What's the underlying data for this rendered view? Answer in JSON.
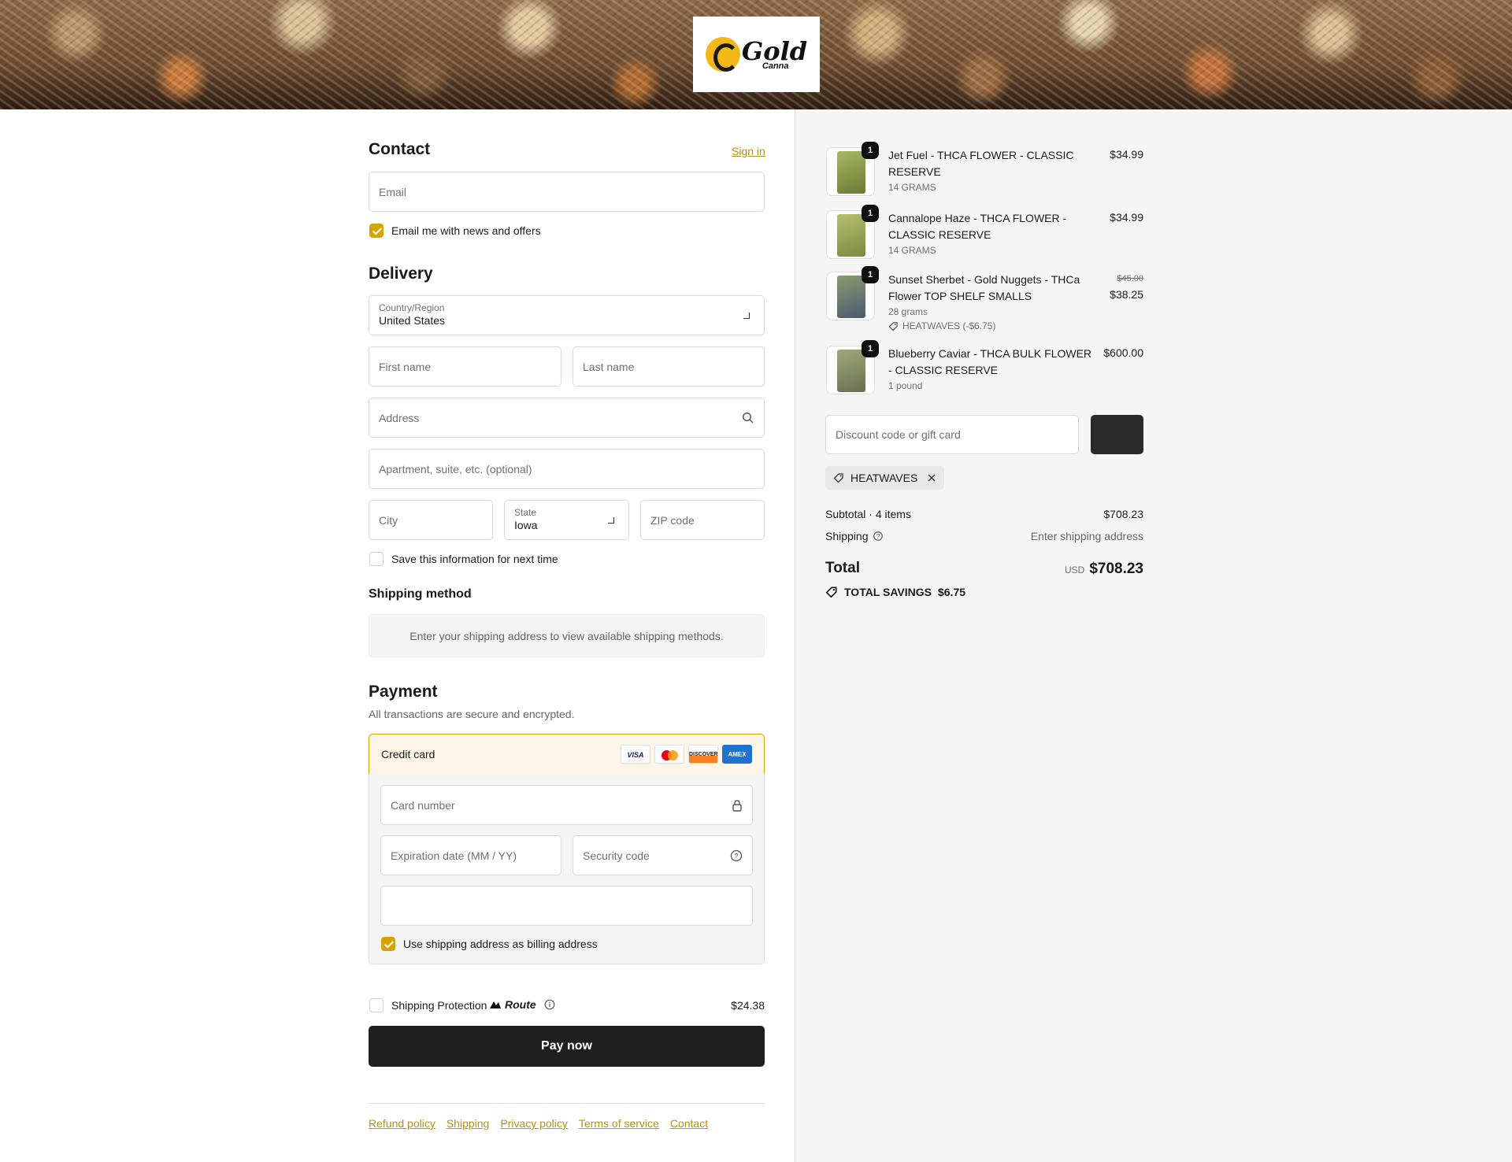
{
  "brand": {
    "logo_word": "Gold",
    "logo_sub": "Canna"
  },
  "contact": {
    "title": "Contact",
    "sign_in": "Sign in",
    "email_placeholder": "Email",
    "news_label": "Email me with news and offers"
  },
  "delivery": {
    "title": "Delivery",
    "country_label": "Country/Region",
    "country_value": "United States",
    "first_name_placeholder": "First name",
    "last_name_placeholder": "Last name",
    "address_placeholder": "Address",
    "apartment_placeholder": "Apartment, suite, etc. (optional)",
    "city_placeholder": "City",
    "state_label": "State",
    "state_value": "Iowa",
    "zip_placeholder": "ZIP code",
    "save_info_label": "Save this information for next time"
  },
  "shipping_method": {
    "title": "Shipping method",
    "notice": "Enter your shipping address to view available shipping methods."
  },
  "payment": {
    "title": "Payment",
    "subtitle": "All transactions are secure and encrypted.",
    "method_label": "Credit card",
    "card_brands": [
      "VISA",
      "MC",
      "DISCOVER",
      "AMEX"
    ],
    "card_number_placeholder": "Card number",
    "expiration_placeholder": "Expiration date (MM / YY)",
    "security_placeholder": "Security code",
    "billing_same_label": "Use shipping address as billing address"
  },
  "protection": {
    "label": "Shipping Protection",
    "brand": "Route",
    "price": "$24.38"
  },
  "pay_button": "Pay now",
  "footer_links": [
    "Refund policy",
    "Shipping",
    "Privacy policy",
    "Terms of service",
    "Contact"
  ],
  "cart": {
    "items": [
      {
        "title": "Jet Fuel - THCA FLOWER - CLASSIC RESERVE",
        "variant": "14 GRAMS",
        "price": "$34.99",
        "qty": "1",
        "color": "#8a9a48"
      },
      {
        "title": "Cannalope Haze - THCA FLOWER - CLASSIC RESERVE",
        "variant": "14 GRAMS",
        "price": "$34.99",
        "qty": "1",
        "color": "#9aa850"
      },
      {
        "title": "Sunset Sherbet - Gold Nuggets - THCa Flower TOP SHELF SMALLS",
        "variant": "28 grams",
        "discount": "HEATWAVES (-$6.75)",
        "original_price": "$45.00",
        "price": "$38.25",
        "qty": "1",
        "color": "#6a7a5a"
      },
      {
        "title": "Blueberry Caviar - THCA BULK FLOWER - CLASSIC RESERVE",
        "variant": "1 pound",
        "price": "$600.00",
        "qty": "1",
        "color": "#8a9070"
      }
    ],
    "discount_placeholder": "Discount code or gift card",
    "applied_code": "HEATWAVES",
    "subtotal_label": "Subtotal · 4 items",
    "subtotal_value": "$708.23",
    "shipping_label": "Shipping",
    "shipping_value": "Enter shipping address",
    "total_label": "Total",
    "currency": "USD",
    "total_value": "$708.23",
    "savings_label": "TOTAL SAVINGS",
    "savings_value": "$6.75"
  },
  "colors": {
    "accent": "#d6a400",
    "button": "#1f1f1f",
    "summary_bg": "#f5f5f5"
  }
}
